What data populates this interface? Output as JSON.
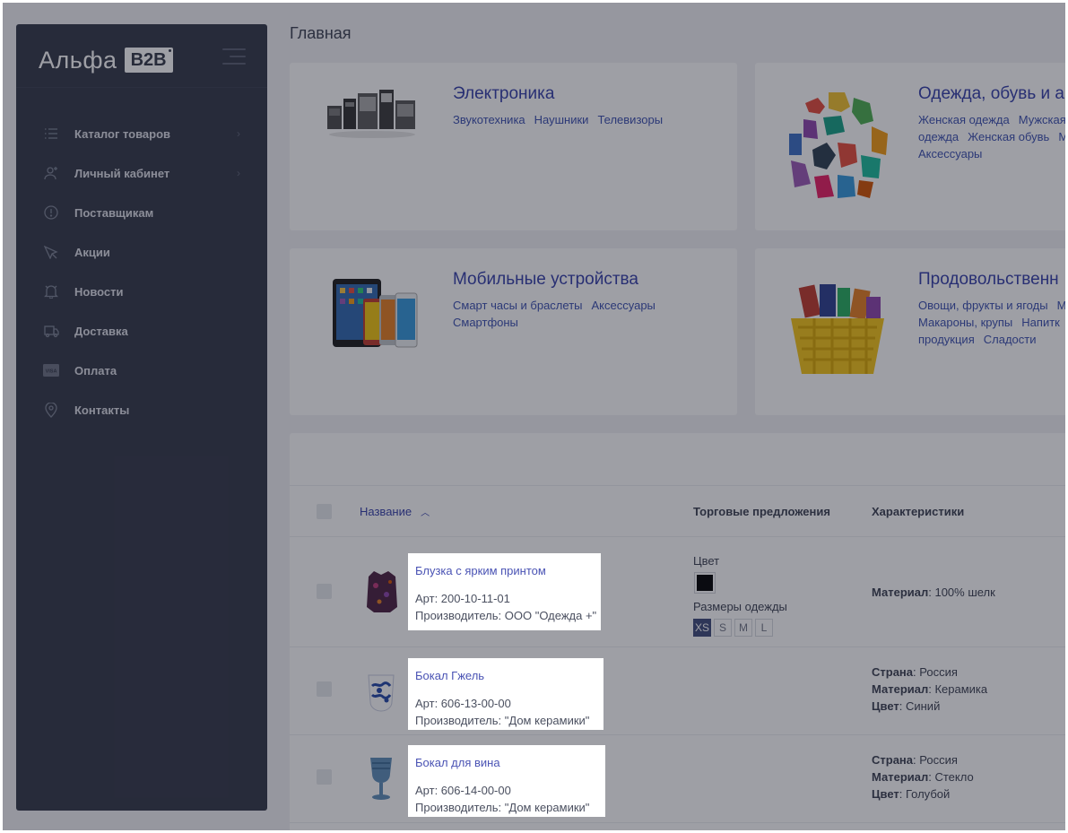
{
  "brand": {
    "name": "Альфа",
    "badge": "B2B"
  },
  "page_title": "Главная",
  "sidebar": {
    "items": [
      {
        "label": "Каталог товаров",
        "icon": "list-icon",
        "has_arrow": true
      },
      {
        "label": "Личный кабинет",
        "icon": "user-icon",
        "has_arrow": true
      },
      {
        "label": "Поставщикам",
        "icon": "alert-circle-icon",
        "has_arrow": false
      },
      {
        "label": "Акции",
        "icon": "tag-icon",
        "has_arrow": false
      },
      {
        "label": "Новости",
        "icon": "bell-icon",
        "has_arrow": false
      },
      {
        "label": "Доставка",
        "icon": "truck-icon",
        "has_arrow": false
      },
      {
        "label": "Оплата",
        "icon": "visa-card-icon",
        "has_arrow": false
      },
      {
        "label": "Контакты",
        "icon": "location-pin-icon",
        "has_arrow": false
      }
    ]
  },
  "categories": [
    {
      "title": "Электроника",
      "links": [
        "Звукотехника",
        "Наушники",
        "Телевизоры"
      ]
    },
    {
      "title": "Одежда, обувь и а",
      "links": [
        "Женская одежда",
        "Мужская",
        "одежда",
        "Женская обувь",
        "М",
        "Аксессуары"
      ]
    },
    {
      "title": "Мобильные устройства",
      "links": [
        "Смарт часы и браслеты",
        "Аксессуары",
        "Смартфоны"
      ]
    },
    {
      "title": "Продовольственн",
      "links": [
        "Овощи, фрукты и ягоды",
        "М",
        "Макароны, крупы",
        "Напитк",
        "продукция",
        "Сладости"
      ]
    }
  ],
  "table": {
    "headers": {
      "name": "Название",
      "offers": "Торговые предложения",
      "chars": "Характеристики"
    },
    "rows": [
      {
        "name": "Блузка с ярким принтом",
        "art": "Арт: 200-10-11-01",
        "maker": "Производитель: ООО \"Одежда +\"",
        "offers": {
          "color_label": "Цвет",
          "color": "#000000",
          "size_label": "Размеры одежды",
          "sizes": [
            "XS",
            "S",
            "M",
            "L"
          ],
          "selected_size": "XS"
        },
        "chars": [
          {
            "k": "Материал",
            "v": ": 100% шелк"
          }
        ]
      },
      {
        "name": "Бокал Гжель",
        "art": "Арт: 606-13-00-00",
        "maker": "Производитель: \"Дом керамики\"",
        "chars": [
          {
            "k": "Страна",
            "v": ": Россия"
          },
          {
            "k": "Материал",
            "v": ": Керамика"
          },
          {
            "k": "Цвет",
            "v": ": Синий"
          }
        ]
      },
      {
        "name": "Бокал для вина",
        "art": "Арт: 606-14-00-00",
        "maker": "Производитель: \"Дом керамики\"",
        "chars": [
          {
            "k": "Страна",
            "v": ": Россия"
          },
          {
            "k": "Материал",
            "v": ": Стекло"
          },
          {
            "k": "Цвет",
            "v": ": Голубой"
          }
        ]
      }
    ]
  },
  "colors": {
    "sidebar_bg": "#333848",
    "link": "#343fa9",
    "overlay": "rgba(24,26,40,0.42)"
  }
}
